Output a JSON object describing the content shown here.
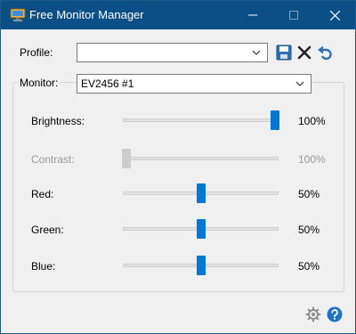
{
  "window": {
    "title": "Free Monitor Manager",
    "titlebar_color": "#0a4f86",
    "icons": {
      "app": "monitor-app-icon",
      "minimize": "minimize-icon",
      "maximize": "maximize-icon",
      "close": "close-icon"
    }
  },
  "profile": {
    "label": "Profile:",
    "value": "",
    "toolbar": {
      "save": "save-icon",
      "delete": "delete-x-icon",
      "undo": "undo-arrow-icon"
    }
  },
  "monitor": {
    "label": "Monitor:",
    "value": "EV2456 #1"
  },
  "sliders": [
    {
      "label": "Brightness:",
      "value_text": "100%",
      "value": 100,
      "enabled": true
    },
    {
      "label": "Contrast:",
      "value_text": "100%",
      "value": 0,
      "enabled": false
    },
    {
      "label": "Red:",
      "value_text": "50%",
      "value": 50,
      "enabled": true
    },
    {
      "label": "Green:",
      "value_text": "50%",
      "value": 50,
      "enabled": true
    },
    {
      "label": "Blue:",
      "value_text": "50%",
      "value": 50,
      "enabled": true
    }
  ],
  "footer": {
    "settings": "gear-icon",
    "help": "help-icon"
  },
  "colors": {
    "accent": "#0078d7",
    "help": "#1e73c8",
    "toolbar_blue": "#2f6fb5"
  }
}
